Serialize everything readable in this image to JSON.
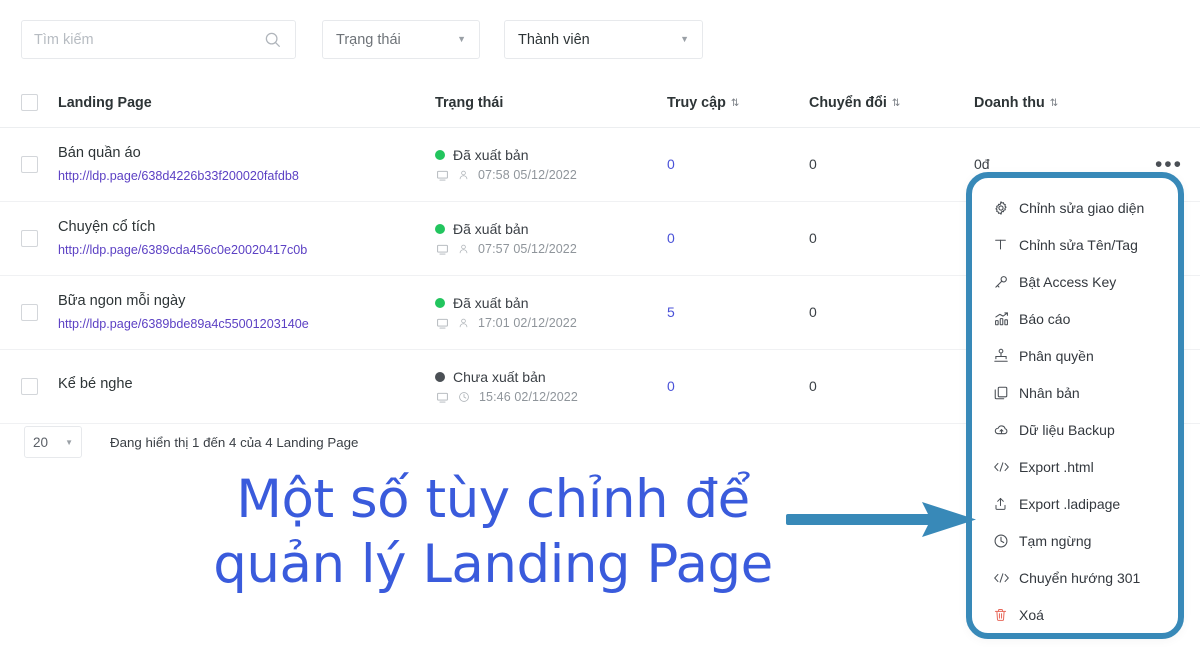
{
  "toolbar": {
    "search": {
      "placeholder": "Tìm kiếm",
      "value": "",
      "icon": "search-icon"
    },
    "filters": [
      {
        "label": "Trạng thái",
        "icon": "chevron-down-icon"
      },
      {
        "label": "Thành viên",
        "icon": "chevron-down-icon"
      }
    ]
  },
  "table": {
    "columns": [
      {
        "key": "name",
        "label": "Landing Page",
        "sortable": false
      },
      {
        "key": "status",
        "label": "Trạng thái",
        "sortable": false
      },
      {
        "key": "visits",
        "label": "Truy cập",
        "sortable": true
      },
      {
        "key": "convs",
        "label": "Chuyển đổi",
        "sortable": true
      },
      {
        "key": "revenue",
        "label": "Doanh thu",
        "sortable": true
      }
    ],
    "sort_icon": "⇅",
    "rows": [
      {
        "title": "Bán quần áo",
        "url": "http://ldp.page/638d4226b33f200020fafdb8",
        "status_text": "Đã xuất bản",
        "status_color": "#22c55e",
        "meta_icon_1": "monitor-icon",
        "meta_icon_2": "user-icon",
        "time": "07:58 05/12/2022",
        "visits": "0",
        "conversions": "0",
        "revenue": "0đ"
      },
      {
        "title": "Chuyện cổ tích",
        "url": "http://ldp.page/6389cda456c0e20020417c0b",
        "status_text": "Đã xuất bản",
        "status_color": "#22c55e",
        "meta_icon_1": "monitor-icon",
        "meta_icon_2": "user-icon",
        "time": "07:57 05/12/2022",
        "visits": "0",
        "conversions": "0",
        "revenue": ""
      },
      {
        "title": "Bữa ngon mỗi ngày",
        "url": "http://ldp.page/6389bde89a4c55001203140e",
        "status_text": "Đã xuất bản",
        "status_color": "#22c55e",
        "meta_icon_1": "monitor-icon",
        "meta_icon_2": "user-icon",
        "time": "17:01 02/12/2022",
        "visits": "5",
        "conversions": "0",
        "revenue": ""
      },
      {
        "title": "Kể bé nghe",
        "url": "",
        "status_text": "Chưa xuất bản",
        "status_color": "#4b5055",
        "meta_icon_1": "monitor-icon",
        "meta_icon_2": "clock-icon",
        "time": "15:46 02/12/2022",
        "visits": "0",
        "conversions": "0",
        "revenue": ""
      }
    ],
    "kebab_glyph": "•••"
  },
  "footer": {
    "per_page": "20",
    "per_page_caret": "▼",
    "showing": "Đang hiển thị 1 đến 4 của 4 Landing Page"
  },
  "action_menu": {
    "border_color": "#3889b8",
    "items": [
      {
        "label": "Chỉnh sửa giao diện",
        "icon": "gear-icon",
        "danger": false
      },
      {
        "label": "Chỉnh sửa Tên/Tag",
        "icon": "text-icon",
        "danger": false
      },
      {
        "label": "Bật Access Key",
        "icon": "key-icon",
        "danger": false
      },
      {
        "label": "Báo cáo",
        "icon": "bar-chart-icon",
        "danger": false
      },
      {
        "label": "Phân quyền",
        "icon": "permissions-icon",
        "danger": false
      },
      {
        "label": "Nhân bản",
        "icon": "copy-icon",
        "danger": false
      },
      {
        "label": "Dữ liệu Backup",
        "icon": "cloud-backup-icon",
        "danger": false
      },
      {
        "label": "Export .html",
        "icon": "code-icon",
        "danger": false
      },
      {
        "label": "Export .ladipage",
        "icon": "upload-icon",
        "danger": false
      },
      {
        "label": "Tạm ngừng",
        "icon": "pause-clock-icon",
        "danger": false
      },
      {
        "label": "Chuyển hướng 301",
        "icon": "code-icon",
        "danger": false
      },
      {
        "label": "Xoá",
        "icon": "trash-icon",
        "danger": true
      }
    ]
  },
  "annotation": {
    "text": "Một số tùy chỉnh để quản lý Landing Page",
    "text_color": "#3a5bdc",
    "arrow_color": "#3889b8",
    "arrow_icon": "right-arrow-icon"
  }
}
